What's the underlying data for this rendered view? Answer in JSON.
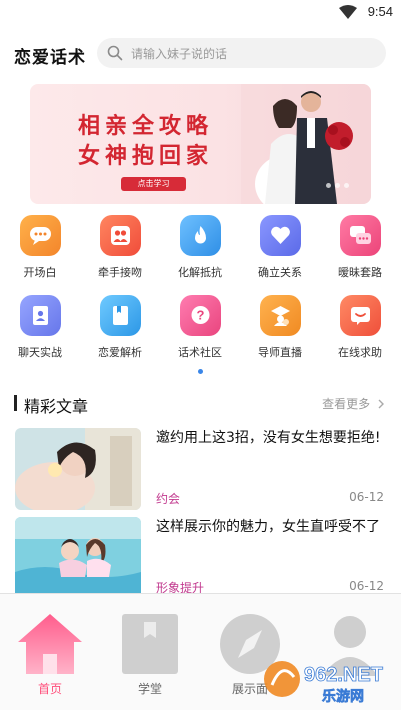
{
  "status": {
    "time": "9:54"
  },
  "header": {
    "title": "恋爱话术",
    "search_placeholder": "请输入妹子说的话"
  },
  "banner": {
    "line1": "相亲全攻略",
    "line2": "女神抱回家",
    "cta": "点击学习",
    "slide_count": 3
  },
  "features": [
    {
      "label": "开场白",
      "icon": "chat-bubble-icon",
      "color": "#f79b3c"
    },
    {
      "label": "牵手接吻",
      "icon": "couple-icon",
      "color": "#f5684a"
    },
    {
      "label": "化解抵抗",
      "icon": "flame-icon",
      "color": "#4aa8f0"
    },
    {
      "label": "确立关系",
      "icon": "heart-icon",
      "color": "#6f7df2"
    },
    {
      "label": "暧昧套路",
      "icon": "chat-double-icon",
      "color": "#f45e8a"
    },
    {
      "label": "聊天实战",
      "icon": "contact-book-icon",
      "color": "#7b8cf4"
    },
    {
      "label": "恋爱解析",
      "icon": "book-icon",
      "color": "#4db2f2"
    },
    {
      "label": "话术社区",
      "icon": "question-icon",
      "color": "#f35d94"
    },
    {
      "label": "导师直播",
      "icon": "mentor-icon",
      "color": "#f5942f"
    },
    {
      "label": "在线求助",
      "icon": "help-chat-icon",
      "color": "#f56a4e"
    }
  ],
  "section": {
    "title": "精彩文章",
    "more": "查看更多"
  },
  "articles": [
    {
      "title": "邀约用上这3招，没有女生想要拒绝!",
      "tag": "约会",
      "date": "06-12"
    },
    {
      "title": "这样展示你的魅力，女生直呼受不了",
      "tag": "形象提升",
      "date": "06-12"
    }
  ],
  "tabs": [
    {
      "label": "首页",
      "icon": "home-icon",
      "active": true
    },
    {
      "label": "学堂",
      "icon": "bookmark-icon",
      "active": false
    },
    {
      "label": "展示面",
      "icon": "compass-icon",
      "active": false
    },
    {
      "label": "",
      "icon": "profile-icon",
      "active": false
    }
  ],
  "watermark": {
    "brand": "962.NET",
    "sub": "乐游网"
  },
  "colors": {
    "accent": "#ff4f7b",
    "tag": "#c23a8f",
    "banner_red": "#d32631"
  }
}
